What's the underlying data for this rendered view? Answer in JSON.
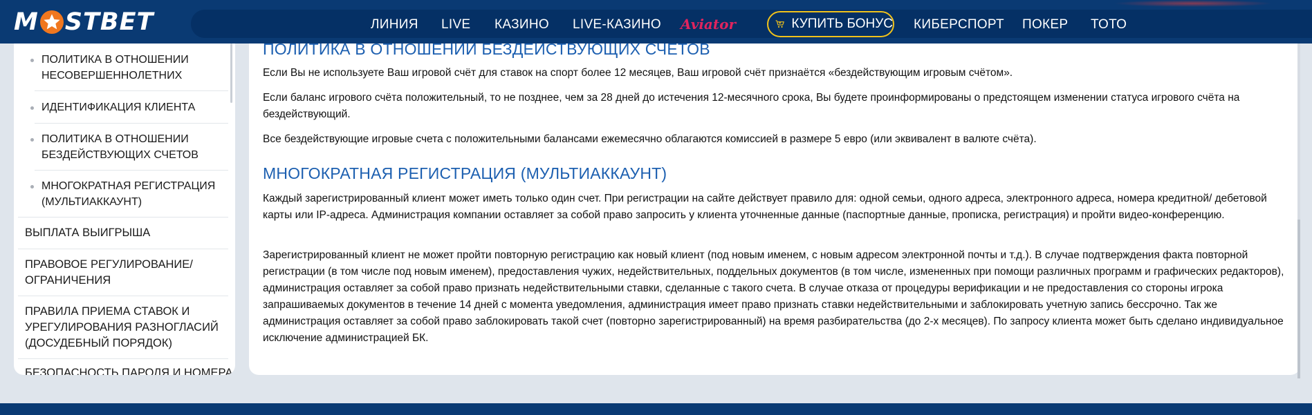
{
  "header": {
    "logo_left": "M",
    "logo_right": "STBET",
    "nav": [
      "ЛИНИЯ",
      "LIVE",
      "КАЗИНО",
      "LIVE-КАЗИНО"
    ],
    "aviator": "Aviator",
    "bonus_button": "КУПИТЬ БОНУС",
    "nav_right": [
      "КИБЕРСПОРТ",
      "ПОКЕР",
      "ТОТО"
    ]
  },
  "sidebar": {
    "sub_items": [
      "ПОЛИТИКА В ОТНОШЕНИИ НЕСОВЕРШЕННОЛЕТНИХ",
      "ИДЕНТИФИКАЦИЯ КЛИЕНТА",
      "ПОЛИТИКА В ОТНОШЕНИИ БЕЗДЕЙСТВУЮЩИХ СЧЕТОВ",
      "МНОГОКРАТНАЯ РЕГИСТРАЦИЯ (МУЛЬТИАККАУНТ)"
    ],
    "main_items": [
      "ВЫПЛАТА ВЫИГРЫША",
      "ПРАВОВОЕ РЕГУЛИРОВАНИЕ/ ОГРАНИЧЕНИЯ",
      "ПРАВИЛА ПРИЕМА СТАВОК И УРЕГУЛИРОВАНИЯ РАЗНОГЛАСИЙ (ДОСУДЕБНЫЙ ПОРЯДОК)",
      "БЕЗОПАСНОСТЬ ПАРОЛЯ И НОМЕРА"
    ]
  },
  "content": {
    "section1": {
      "title": "ПОЛИТИКА В ОТНОШЕНИИ БЕЗДЕЙСТВУЮЩИХ СЧЕТОВ",
      "paragraphs": [
        "Если Вы не используете Ваш игровой счёт для ставок на спорт более 12 месяцев, Ваш игровой счёт признаётся «бездействующим игровым счётом».",
        "Если баланс игрового счёта положительный, то не позднее, чем за 28 дней до истечения 12-месячного срока, Вы будете проинформированы о предстоящем изменении статуса игрового счёта на бездействующий.",
        "Все бездействующие игровые счета с положительными балансами ежемесячно облагаются комиссией в размере 5 евро (или эквивалент в валюте счёта)."
      ]
    },
    "section2": {
      "title": "МНОГОКРАТНАЯ РЕГИСТРАЦИЯ (МУЛЬТИАККАУНТ)",
      "paragraphs": [
        "Каждый зарегистрированный клиент может иметь только один счет. При регистрации на сайте действует правило для: одной семьи, одного адреса, электронного адреса, номера кредитной/ дебетовой карты или IP-адреса. Администрация компании оставляет за собой право запросить у клиента уточненные данные (паспортные данные, прописка, регистрация) и пройти видео-конференцию.",
        "Зарегистрированный клиент не может пройти повторную регистрацию как новый клиент (под новым именем, с новым адресом электронной почты и т.д.). В случае подтверждения факта повторной регистрации (в том числе под новым именем), предоставления чужих, недействительных, поддельных документов (в том числе, измененных при помощи различных программ и графических редакторов), администрация оставляет за собой право признать недействительными ставки, сделанные с такого счета. В случае отказа от процедуры верификации и не предоставления со стороны игрока запрашиваемых документов в течение 14 дней с момента уведомления, администрация имеет право признать ставки недействительными и заблокировать учетную запись бессрочно. Так же администрация оставляет за собой право заблокировать такой счет (повторно зарегистрированный) на время разбирательства (до 2-х месяцев). По запросу клиента может быть сделано индивидуальное исключение администрацией БК."
      ]
    }
  },
  "colors": {
    "header_bg": "#0a3a73",
    "accent_orange": "#f0771f",
    "heading_blue": "#1c5fb0",
    "bonus_border": "#f1c21b",
    "aviator_red": "#e0245e"
  }
}
